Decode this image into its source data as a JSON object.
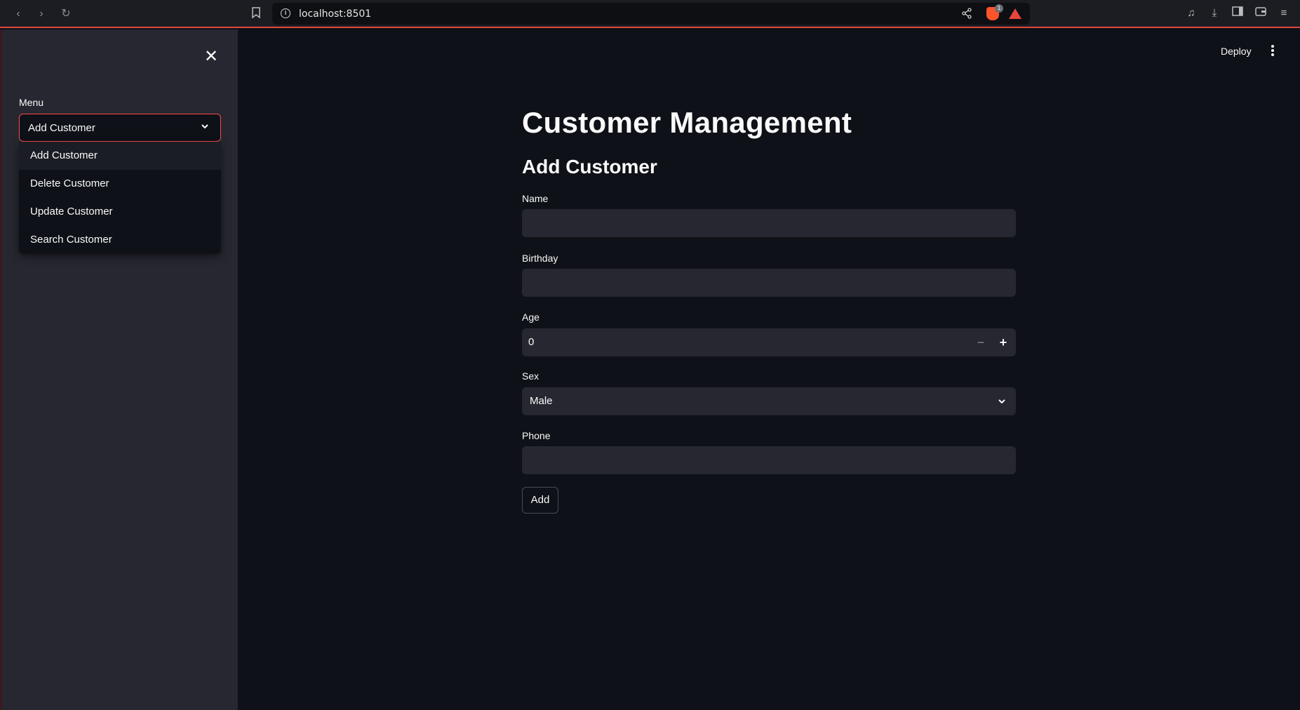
{
  "browser": {
    "url": "localhost:8501",
    "brave_badge": "1"
  },
  "sidebar": {
    "menu_label": "Menu",
    "selected": "Add Customer",
    "options": [
      "Add Customer",
      "Delete Customer",
      "Update Customer",
      "Search Customer"
    ]
  },
  "header": {
    "deploy_label": "Deploy"
  },
  "main": {
    "title": "Customer Management",
    "subheader": "Add Customer",
    "fields": {
      "name_label": "Name",
      "name_value": "",
      "birthday_label": "Birthday",
      "birthday_value": "",
      "age_label": "Age",
      "age_value": "0",
      "sex_label": "Sex",
      "sex_value": "Male",
      "phone_label": "Phone",
      "phone_value": ""
    },
    "add_label": "Add"
  },
  "colors": {
    "accent": "#ff4b4b",
    "background": "#0e1117",
    "sidebar": "#262730",
    "input": "#262730"
  }
}
